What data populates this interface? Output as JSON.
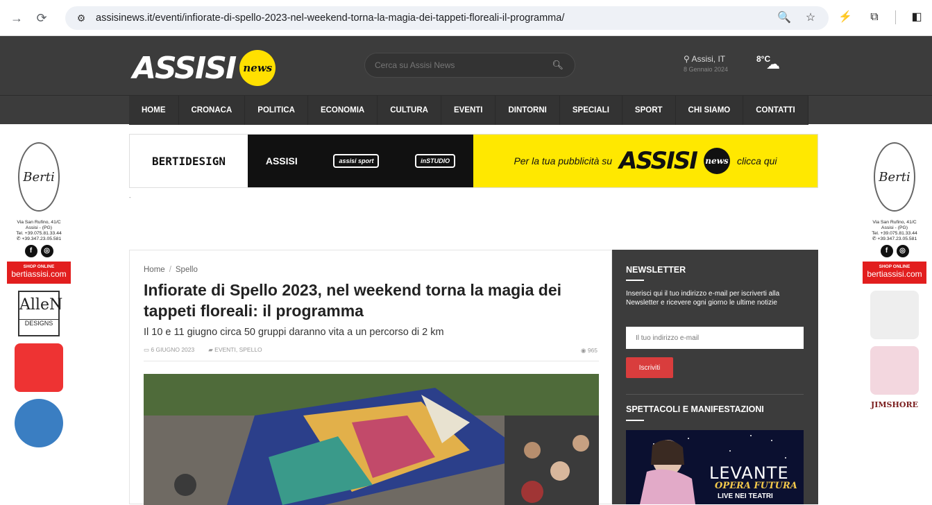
{
  "browser": {
    "url": "assisinews.it/eventi/infiorate-di-spello-2023-nel-weekend-torna-la-magia-dei-tappeti-floreali-il-programma/"
  },
  "site": {
    "logo_text": "ASSISI",
    "logo_badge": "news",
    "search_placeholder": "Cerca su Assisi News",
    "location": "Assisi, IT",
    "date": "8 Gennaio 2024",
    "temperature": "8°C"
  },
  "menu": [
    "HOME",
    "CRONACA",
    "POLITICA",
    "ECONOMIA",
    "CULTURA",
    "EVENTI",
    "DINTORNI",
    "SPECIALI",
    "SPORT",
    "CHI SIAMO",
    "CONTATTI"
  ],
  "banner": {
    "brand1": "BERTIDESIGN",
    "brand2": "ASSISI",
    "brand3": "assisi sport",
    "brand4": "inSTUDIO",
    "promo_text": "Per la tua pubblicità su",
    "promo_logo": "ASSISI",
    "promo_badge": "news",
    "promo_cta": "clicca qui"
  },
  "side_ad": {
    "brand": "Berti",
    "address_line1": "Via San Rufino, 41/C",
    "address_line2": "Assisi - (PG)",
    "tel": "Tel. +39.075.81.33.44",
    "whatsapp": "+39.347.23.05.581",
    "shop_label": "SHOP ONLINE",
    "shop_site": "bertiassisi.com",
    "allen": "AlleN",
    "allen_sub": "DESIGNS",
    "jimshore": "JIMSHORE"
  },
  "article": {
    "breadcrumb_home": "Home",
    "breadcrumb_sep": "/",
    "breadcrumb_cat": "Spello",
    "title": "Infiorate di Spello 2023, nel weekend torna la magia dei tappeti floreali: il programma",
    "subtitle": "Il 10 e 11 giugno circa 50 gruppi daranno vita a un percorso di 2 km",
    "date": "6 GIUGNO 2023",
    "categories": "EVENTI, SPELLO",
    "views": "965"
  },
  "sidebar": {
    "newsletter_title": "NEWSLETTER",
    "newsletter_text": "Inserisci qui il tuo indirizzo e-mail per iscriverti alla Newsletter e ricevere ogni giorno le ultime notizie",
    "email_placeholder": "Il tuo indirizzo e-mail",
    "subscribe_label": "Iscriviti",
    "events_title": "SPETTACOLI E MANIFESTAZIONI",
    "levante_title": "LEVANTE",
    "levante_sub": "OPERA FUTURA",
    "levante_sub2": "LIVE NEI TEATRI"
  },
  "colors": {
    "header_bg": "#3c3c3c",
    "badge_yellow": "#ffe000",
    "shop_red": "#e21e1e",
    "subscribe_red": "#d93d3d"
  }
}
